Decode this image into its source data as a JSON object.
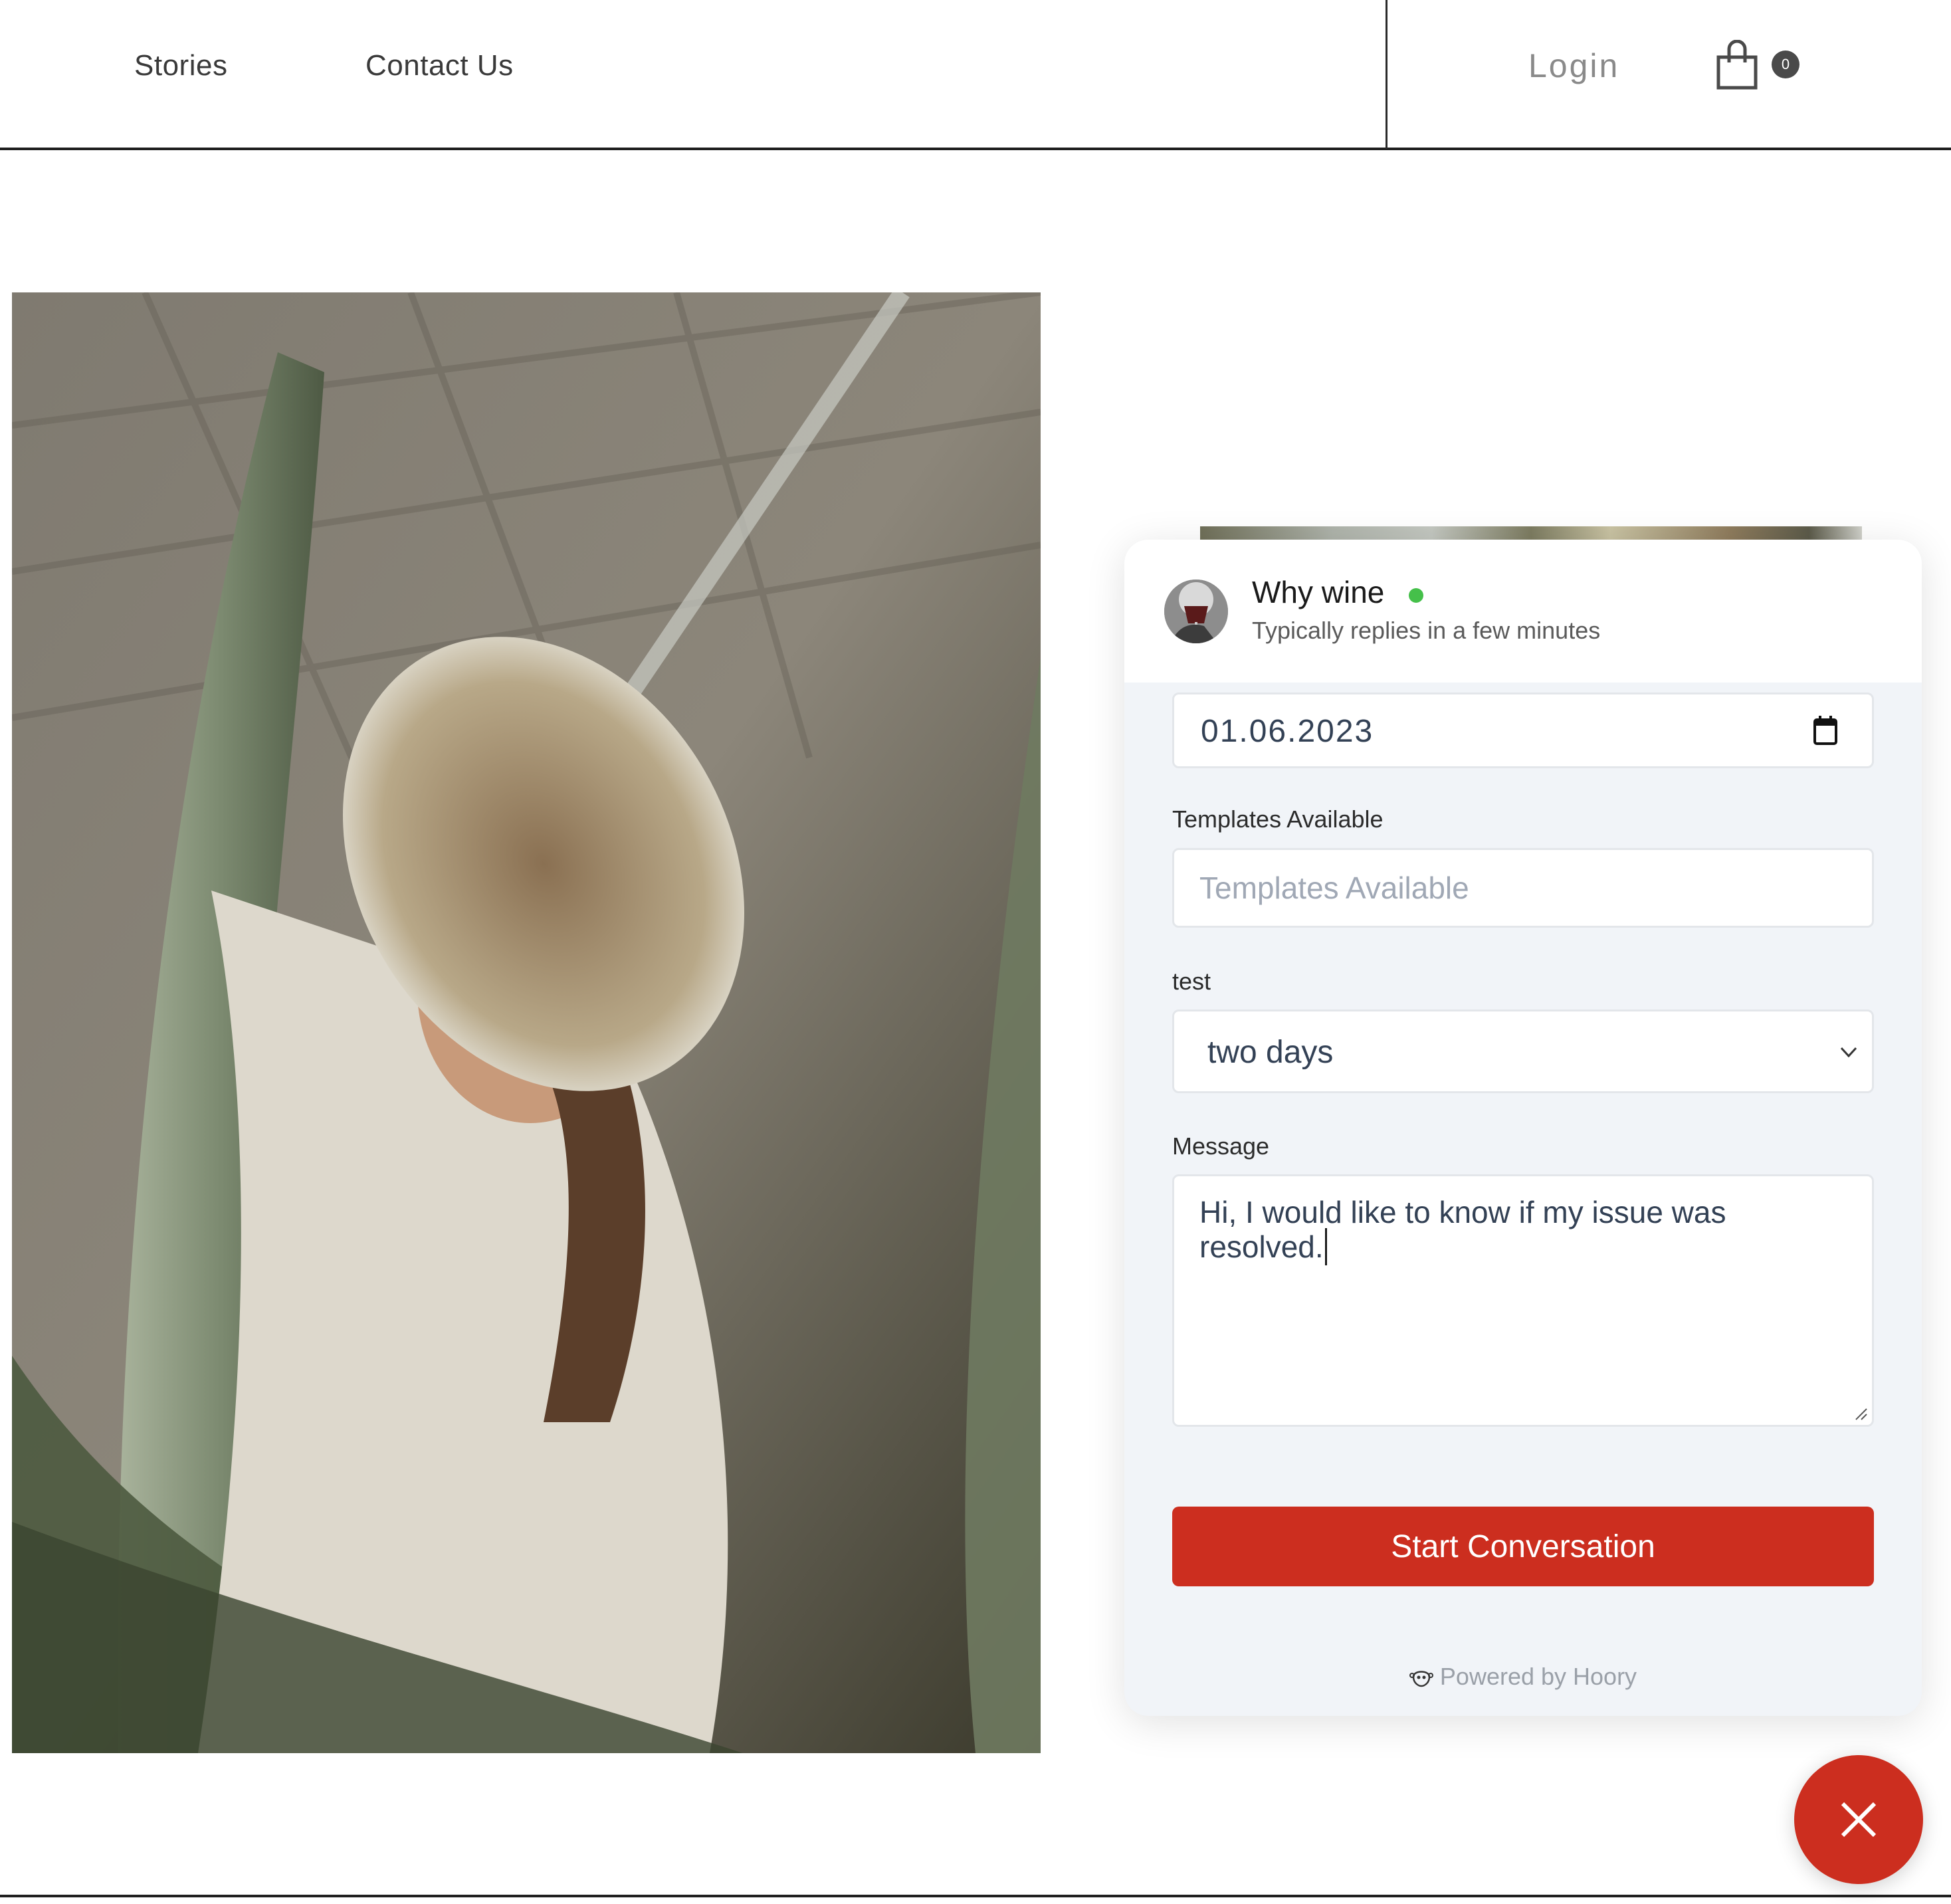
{
  "header": {
    "nav": [
      {
        "label": "Stories"
      },
      {
        "label": "Contact Us"
      }
    ],
    "login_label": "Login",
    "cart": {
      "icon": "shopping-bag-icon",
      "count": "0"
    }
  },
  "hero": {
    "image_description": "Woman in white linen jacket and straw hat among cacti in a greenhouse"
  },
  "chat_widget": {
    "agent_name": "Why wine",
    "status": "online",
    "status_color": "#45c04a",
    "reply_time": "Typically replies in a few minutes",
    "form": {
      "date": {
        "value": "01.06.2023",
        "icon": "calendar-icon"
      },
      "templates": {
        "label": "Templates Available",
        "placeholder": "Templates Available",
        "value": ""
      },
      "test": {
        "label": "test",
        "selected": "two days",
        "icon": "chevron-down-icon"
      },
      "message": {
        "label": "Message",
        "value": "Hi, I would like to know if my issue was resolved."
      }
    },
    "submit_label": "Start Conversation",
    "powered_by": "Powered by Hoory",
    "accent_color": "#cc2e1f"
  },
  "launcher": {
    "icon": "close-icon"
  }
}
